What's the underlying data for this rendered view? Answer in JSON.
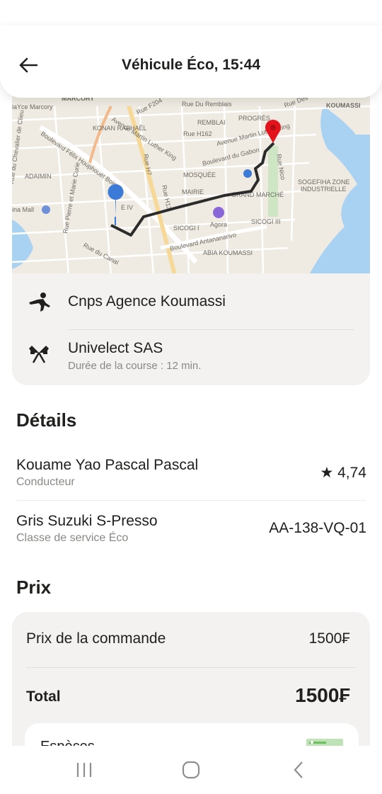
{
  "header": {
    "title": "Véhicule Éco, 15:44",
    "back_icon": "arrow-left-icon"
  },
  "map": {
    "labels": [
      "MARCORY",
      "iaYce Marcory",
      "Rue F204",
      "Rue Du Remblais",
      "Rue Des",
      "KOUMASSI",
      "REMBLAI",
      "PROGRÈS",
      "Avenue Martin Luther King",
      "Rue H162",
      "Avenue Martin Luther King",
      "KONAN RAPHAËL",
      "Boulevard Félix Houphouët Boigny",
      "Rue H7",
      "Boulevard du Gabon",
      "Rue Nico",
      "Rue du Chevalier de Clieu",
      "ADAIMIN",
      "Rue Pierre et Marie Curie",
      "MOSQUÉE",
      "SOGEFIHA ZONE",
      "INDUSTRIELLE",
      "Rue H13",
      "MAIRIE",
      "GRAND MARCHÉ",
      "ina Mall",
      "Agora",
      "SICOGI I",
      "SICOGI III",
      "Boulevard Antananarivo",
      "ABIA KOUMASSI",
      "Rue du Canal",
      "E IV"
    ],
    "pickup_marker": "blue-pin-icon",
    "destination_marker": "red-pin-icon",
    "route_color": "#2b2b2b",
    "water_color": "#a9d1f2"
  },
  "route": {
    "from": "Cnps Agence Koumassi",
    "from_icon": "walking-person-icon",
    "to": "Univelect SAS",
    "to_icon": "checkered-flags-icon",
    "duration": "Durée de la course : 12 min."
  },
  "details": {
    "title": "Détails",
    "driver_name": "Kouame Yao Pascal Pascal",
    "driver_role": "Conducteur",
    "rating": "★ 4,74",
    "car": "Gris Suzuki S-Presso",
    "service_class": "Classe de service Éco",
    "plate": "AA-138-VQ-01"
  },
  "price": {
    "title": "Prix",
    "order_label": "Prix de la commande",
    "order_value": "1500₣",
    "total_label": "Total",
    "total_value": "1500₣",
    "payment_label": "Espèces",
    "payment_icon": "cash-icon"
  },
  "nav": {
    "recent": "recent-apps-icon",
    "home": "home-icon",
    "back": "back-chevron-icon"
  },
  "colors": {
    "card_bg": "#f3f2f0",
    "text": "#21201f",
    "muted": "#8a8884",
    "pin_pickup": "#3b7ad6",
    "pin_dest": "#e3141b"
  }
}
